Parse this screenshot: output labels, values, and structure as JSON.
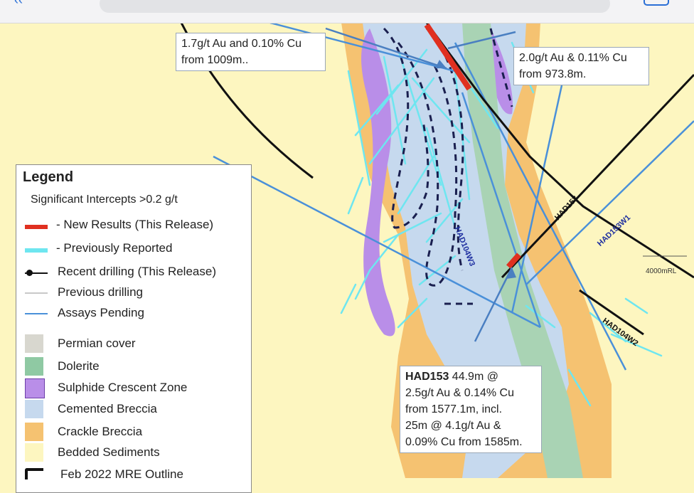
{
  "browser": {
    "back_icon": "back-arrow-icon",
    "tabs_icon": "tabs-icon"
  },
  "callouts": {
    "top_left": {
      "line1": "1.7g/t Au and 0.10% Cu",
      "line2": "from 1009m.."
    },
    "top_right": {
      "line1": "2.0g/t Au & 0.11% Cu",
      "line2": "from 973.8m."
    },
    "bottom": {
      "hole": "HAD153",
      "line1_rest": " 44.9m @",
      "line2": "2.5g/t Au & 0.14% Cu",
      "line3": "from 1577.1m, incl.",
      "line4": "25m @ 4.1g/t Au &",
      "line5": "0.09% Cu from 1585m."
    }
  },
  "labels": {
    "had104w3": "HAD104W3",
    "had153": "HAD153",
    "had153w1": "HAD153W1",
    "had104w2": "HAD104W2",
    "rl": "4000mRL"
  },
  "legend": {
    "title": "Legend",
    "subtitle": "Significant Intercepts >0.2 g/t",
    "items": [
      {
        "label": "- New Results (This Release)",
        "color": "#e03020"
      },
      {
        "label": "- Previously Reported",
        "color": "#6ee6f0"
      },
      {
        "label": "Recent drilling (This Release)",
        "color": "#111111"
      },
      {
        "label": "Previous drilling",
        "color": "#c8c8c8"
      },
      {
        "label": "Assays Pending",
        "color": "#4a90d9"
      },
      {
        "label": "Permian cover",
        "color": "#d8d7cf"
      },
      {
        "label": "Dolerite",
        "color": "#8fc9a3"
      },
      {
        "label": "Sulphide Crescent Zone",
        "color": "#b98ee8"
      },
      {
        "label": "Cemented Breccia",
        "color": "#c6d9ee"
      },
      {
        "label": "Crackle Breccia",
        "color": "#f5c271"
      },
      {
        "label": "Bedded Sediments",
        "color": "#fdf6c0"
      },
      {
        "label": "Feb 2022 MRE Outline",
        "color": "#111111"
      }
    ]
  }
}
